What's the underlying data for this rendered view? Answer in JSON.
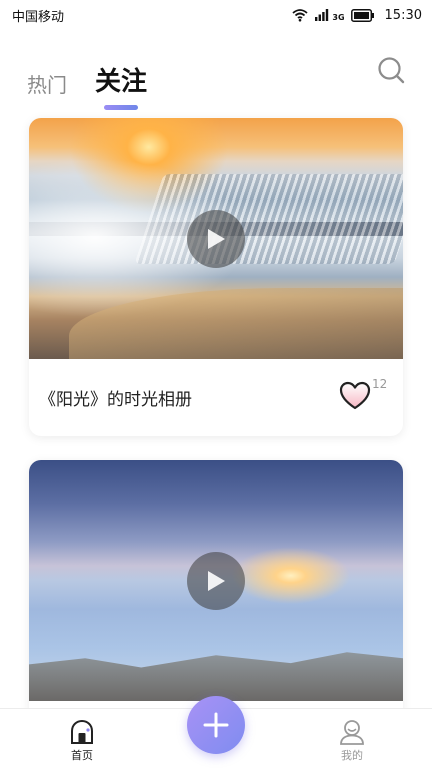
{
  "status_bar": {
    "carrier": "中国移动",
    "network": "3G",
    "time": "15:30"
  },
  "tabs": [
    {
      "label": "热门",
      "active": false
    },
    {
      "label": "关注",
      "active": true
    }
  ],
  "accent_color": "#8f86f0",
  "feed": [
    {
      "title": "《阳光》的时光相册",
      "likes": "12",
      "liked": false
    },
    {
      "title": "",
      "likes": "",
      "liked": false
    }
  ],
  "bottom_nav": {
    "home_label": "首页",
    "mine_label": "我的",
    "add_icon": "plus-icon"
  }
}
